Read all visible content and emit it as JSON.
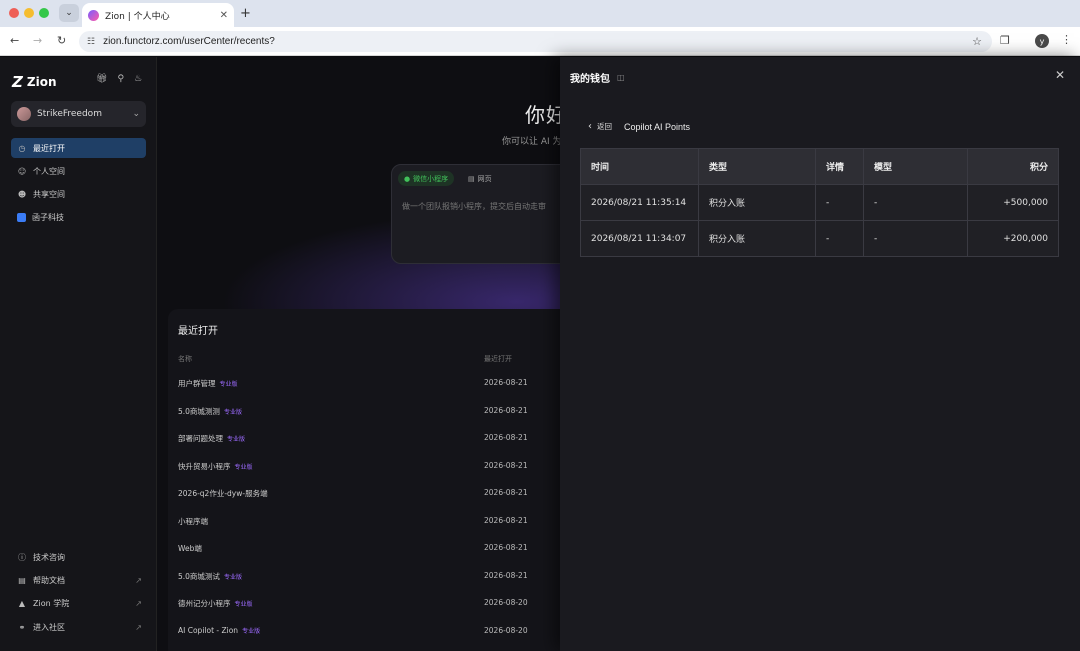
{
  "browser": {
    "tab_title": "Zion | 个人中心",
    "url": "zion.functorz.com/userCenter/recents?",
    "profile_initial": "y"
  },
  "sidebar": {
    "brand": "Zion",
    "user": "StrikeFreedom",
    "nav": [
      {
        "label": "最近打开",
        "icon": "clock-icon",
        "active": true
      },
      {
        "label": "个人空间",
        "icon": "person-icon"
      },
      {
        "label": "共享空间",
        "icon": "people-icon"
      },
      {
        "label": "函子科技",
        "icon": "team-icon"
      }
    ],
    "bottom": [
      {
        "label": "技术咨询",
        "icon": "help-icon"
      },
      {
        "label": "帮助文档",
        "icon": "doc-icon"
      },
      {
        "label": "Zion 学院",
        "icon": "academy-icon"
      },
      {
        "label": "进入社区",
        "icon": "community-icon"
      }
    ]
  },
  "main": {
    "hero_title": "你好",
    "hero_sub": "你可以让 AI 为",
    "chips": {
      "mini": "微信小程序",
      "web": "网页"
    },
    "composer_placeholder": "做一个团队报销小程序，提交后自动走审",
    "recents": {
      "title": "最近打开",
      "col_name": "名称",
      "col_date": "最近打开",
      "pro_label": "专业版",
      "rows": [
        {
          "name": "用户群管理",
          "pro": true,
          "date": "2026-08-21"
        },
        {
          "name": "5.0商城测测",
          "pro": true,
          "date": "2026-08-21"
        },
        {
          "name": "部署问题处理",
          "pro": true,
          "date": "2026-08-21"
        },
        {
          "name": "快升贸易小程序",
          "pro": true,
          "date": "2026-08-21"
        },
        {
          "name": "2026-q2作业-dyw-服务端",
          "pro": false,
          "date": "2026-08-21"
        },
        {
          "name": "小程序端",
          "pro": false,
          "date": "2026-08-21"
        },
        {
          "name": "Web端",
          "pro": false,
          "date": "2026-08-21"
        },
        {
          "name": "5.0商城测试",
          "pro": true,
          "date": "2026-08-21"
        },
        {
          "name": "德州记分小程序",
          "pro": true,
          "date": "2026-08-20"
        },
        {
          "name": "AI Copilot - Zion",
          "pro": true,
          "date": "2026-08-20"
        }
      ]
    }
  },
  "wallet": {
    "title": "我的钱包",
    "back_label": "返回",
    "section_title": "Copilot AI Points",
    "columns": [
      "时间",
      "类型",
      "详情",
      "模型",
      "积分"
    ],
    "rows": [
      {
        "time": "2026/08/21 11:35:14",
        "type": "积分入账",
        "detail": "-",
        "model": "-",
        "points": "+500,000"
      },
      {
        "time": "2026/08/21 11:34:07",
        "type": "积分入账",
        "detail": "-",
        "model": "-",
        "points": "+200,000"
      }
    ]
  }
}
